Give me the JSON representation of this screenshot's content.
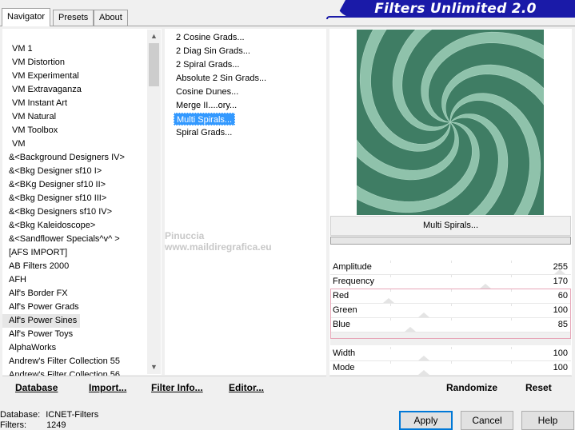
{
  "tabs": [
    {
      "label": "Navigator"
    },
    {
      "label": "Presets"
    },
    {
      "label": "About"
    }
  ],
  "banner": {
    "title": "Filters Unlimited 2.0",
    "color": "#1a1aa8"
  },
  "categories": [
    {
      "label": "VM 1"
    },
    {
      "label": "VM Distortion"
    },
    {
      "label": "VM Experimental"
    },
    {
      "label": "VM Extravaganza"
    },
    {
      "label": "VM Instant Art"
    },
    {
      "label": "VM Natural"
    },
    {
      "label": "VM Toolbox"
    },
    {
      "label": "VM"
    },
    {
      "label": "&<Background Designers IV>"
    },
    {
      "label": "&<Bkg Designer sf10 I>"
    },
    {
      "label": "&<BKg Designer sf10 II>"
    },
    {
      "label": "&<Bkg Designer sf10 III>"
    },
    {
      "label": "&<Bkg Designers sf10 IV>"
    },
    {
      "label": "&<Bkg Kaleidoscope>"
    },
    {
      "label": "&<Sandflower Specials^v^ >"
    },
    {
      "label": "[AFS IMPORT]"
    },
    {
      "label": "AB Filters 2000"
    },
    {
      "label": "AFH"
    },
    {
      "label": "Alf's Border FX"
    },
    {
      "label": "Alf's Power Grads"
    },
    {
      "label": "Alf's Power Sines",
      "selected": true
    },
    {
      "label": "Alf's Power Toys"
    },
    {
      "label": "AlphaWorks"
    },
    {
      "label": "Andrew's Filter Collection 55"
    },
    {
      "label": "Andrew's Filter Collection 56"
    }
  ],
  "filters": [
    {
      "label": "2 Cosine Grads..."
    },
    {
      "label": "2 Diag Sin Grads..."
    },
    {
      "label": "2 Spiral Grads..."
    },
    {
      "label": "Absolute 2 Sin Grads..."
    },
    {
      "label": "Cosine Dunes..."
    },
    {
      "label": "Merge II....ory..."
    },
    {
      "label": "Multi Spirals...",
      "selected": true
    },
    {
      "label": "Spiral Grads..."
    }
  ],
  "preview": {
    "filter_name": "Multi Spirals...",
    "color_light": "#8fc2ab",
    "color_dark": "#3f7d64"
  },
  "params": [
    {
      "name": "Amplitude",
      "value": "255",
      "level": 1.0
    },
    {
      "name": "Frequency",
      "value": "170",
      "level": 0.667
    },
    {
      "name": "Red",
      "value": "60",
      "level": 0.235
    },
    {
      "name": "Green",
      "value": "100",
      "level": 0.392
    },
    {
      "name": "Blue",
      "value": "85",
      "level": 0.333
    },
    {
      "name": "",
      "value": "",
      "level": null
    },
    {
      "name": "Width",
      "value": "100",
      "level": 0.392
    },
    {
      "name": "Mode",
      "value": "100",
      "level": 0.392
    }
  ],
  "left_buttons": {
    "database": "Database",
    "import": "Import...",
    "filter_info": "Filter Info...",
    "editor": "Editor..."
  },
  "right_buttons": {
    "randomize": "Randomize",
    "reset": "Reset"
  },
  "status": {
    "database_label": "Database:",
    "database_value": "ICNET-Filters",
    "filters_label": "Filters:",
    "filters_value": "1249"
  },
  "dialog": {
    "apply": "Apply",
    "cancel": "Cancel",
    "help": "Help"
  },
  "watermark": {
    "line1": "Pinuccia",
    "line2": "www.maildiregrafica.eu"
  }
}
